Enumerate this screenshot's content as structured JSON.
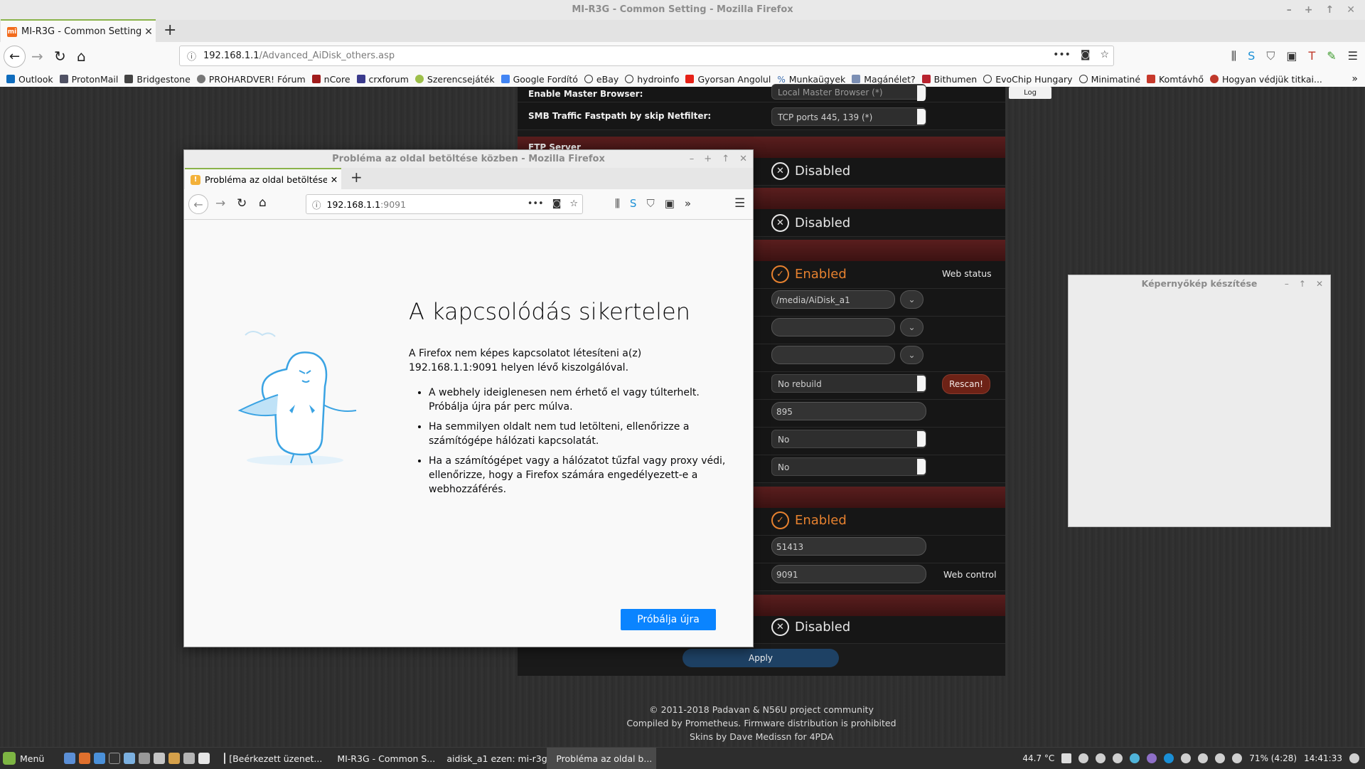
{
  "main_window": {
    "title": "MI-R3G - Common Setting - Mozilla Firefox",
    "tab_title": "MI-R3G - Common Setting",
    "url_host": "192.168.1.1",
    "url_path": "/Advanced_AiDisk_others.asp",
    "bookmarks": [
      "Outlook",
      "ProtonMail",
      "Bridgestone",
      "PROHARDVER! Fórum",
      "nCore",
      "crxforum",
      "Szerencsejáték",
      "Google Fordító",
      "eBay",
      "hydroinfo",
      "Gyorsan Angolul",
      "Munkaügyek",
      "Magánélet?",
      "Bithumen",
      "EvoChip Hungary",
      "Minimatiné",
      "Komtávhő",
      "Hogyan védjük titkai..."
    ]
  },
  "router": {
    "log_label": "Log",
    "rows": {
      "master_browser_label": "Enable Master Browser:",
      "master_browser_value": "Local Master Browser (*)",
      "smb_label": "SMB Traffic Fastpath by skip Netfilter:",
      "smb_value": "TCP ports 445, 139 (*)"
    },
    "ftp_section": "FTP Server",
    "disabled": "Disabled",
    "enabled": "Enabled",
    "web_status": "Web status",
    "media_path": "/media/AiDisk_a1",
    "no_rebuild": "No rebuild",
    "rescan": "Rescan!",
    "value_895": "895",
    "no1": "No",
    "no2": "No",
    "port_51413": "51413",
    "port_9091": "9091",
    "web_control": "Web control",
    "apply": "Apply",
    "footer": [
      "© 2011-2018 Padavan & N56U project community",
      "Compiled by Prometheus. Firmware distribution is prohibited",
      "Skins by Dave Medissn for 4PDA"
    ]
  },
  "popup": {
    "title": "Probléma az oldal betöltése közben - Mozilla Firefox",
    "tab_title": "Probléma az oldal betöltése k",
    "url_host": "192.168.1.1",
    "url_port": ":9091",
    "heading": "A kapcsolódás sikertelen",
    "description": "A Firefox nem képes kapcsolatot létesíteni a(z) 192.168.1.1:9091 helyen lévő kiszolgálóval.",
    "bullets": [
      "A webhely ideiglenesen nem érhető el vagy túlterhelt. Próbálja újra pár perc múlva.",
      "Ha semmilyen oldalt nem tud letölteni, ellenőrizze a számítógépe hálózati kapcsolatát.",
      "Ha a számítógépet vagy a hálózatot tűzfal vagy proxy védi, ellenőrizze, hogy a Firefox számára engedélyezett-e a webhozzáférés."
    ],
    "retry": "Próbálja újra"
  },
  "screenshot_tool": {
    "title": "Képernyőkép készítése"
  },
  "taskbar": {
    "menu": "Menü",
    "tasks": [
      "[Beérkezett üzenet...",
      "MI-R3G - Common S...",
      "aidisk_a1 ezen: mi-r3g",
      "Probléma az oldal b..."
    ],
    "temperature": "44.7 °C",
    "battery": "71% (4:28)",
    "clock": "14:41:33"
  },
  "colors": {
    "accent": "#0a84ff",
    "enabled": "#e6812f",
    "section": "#5a1e1e"
  }
}
